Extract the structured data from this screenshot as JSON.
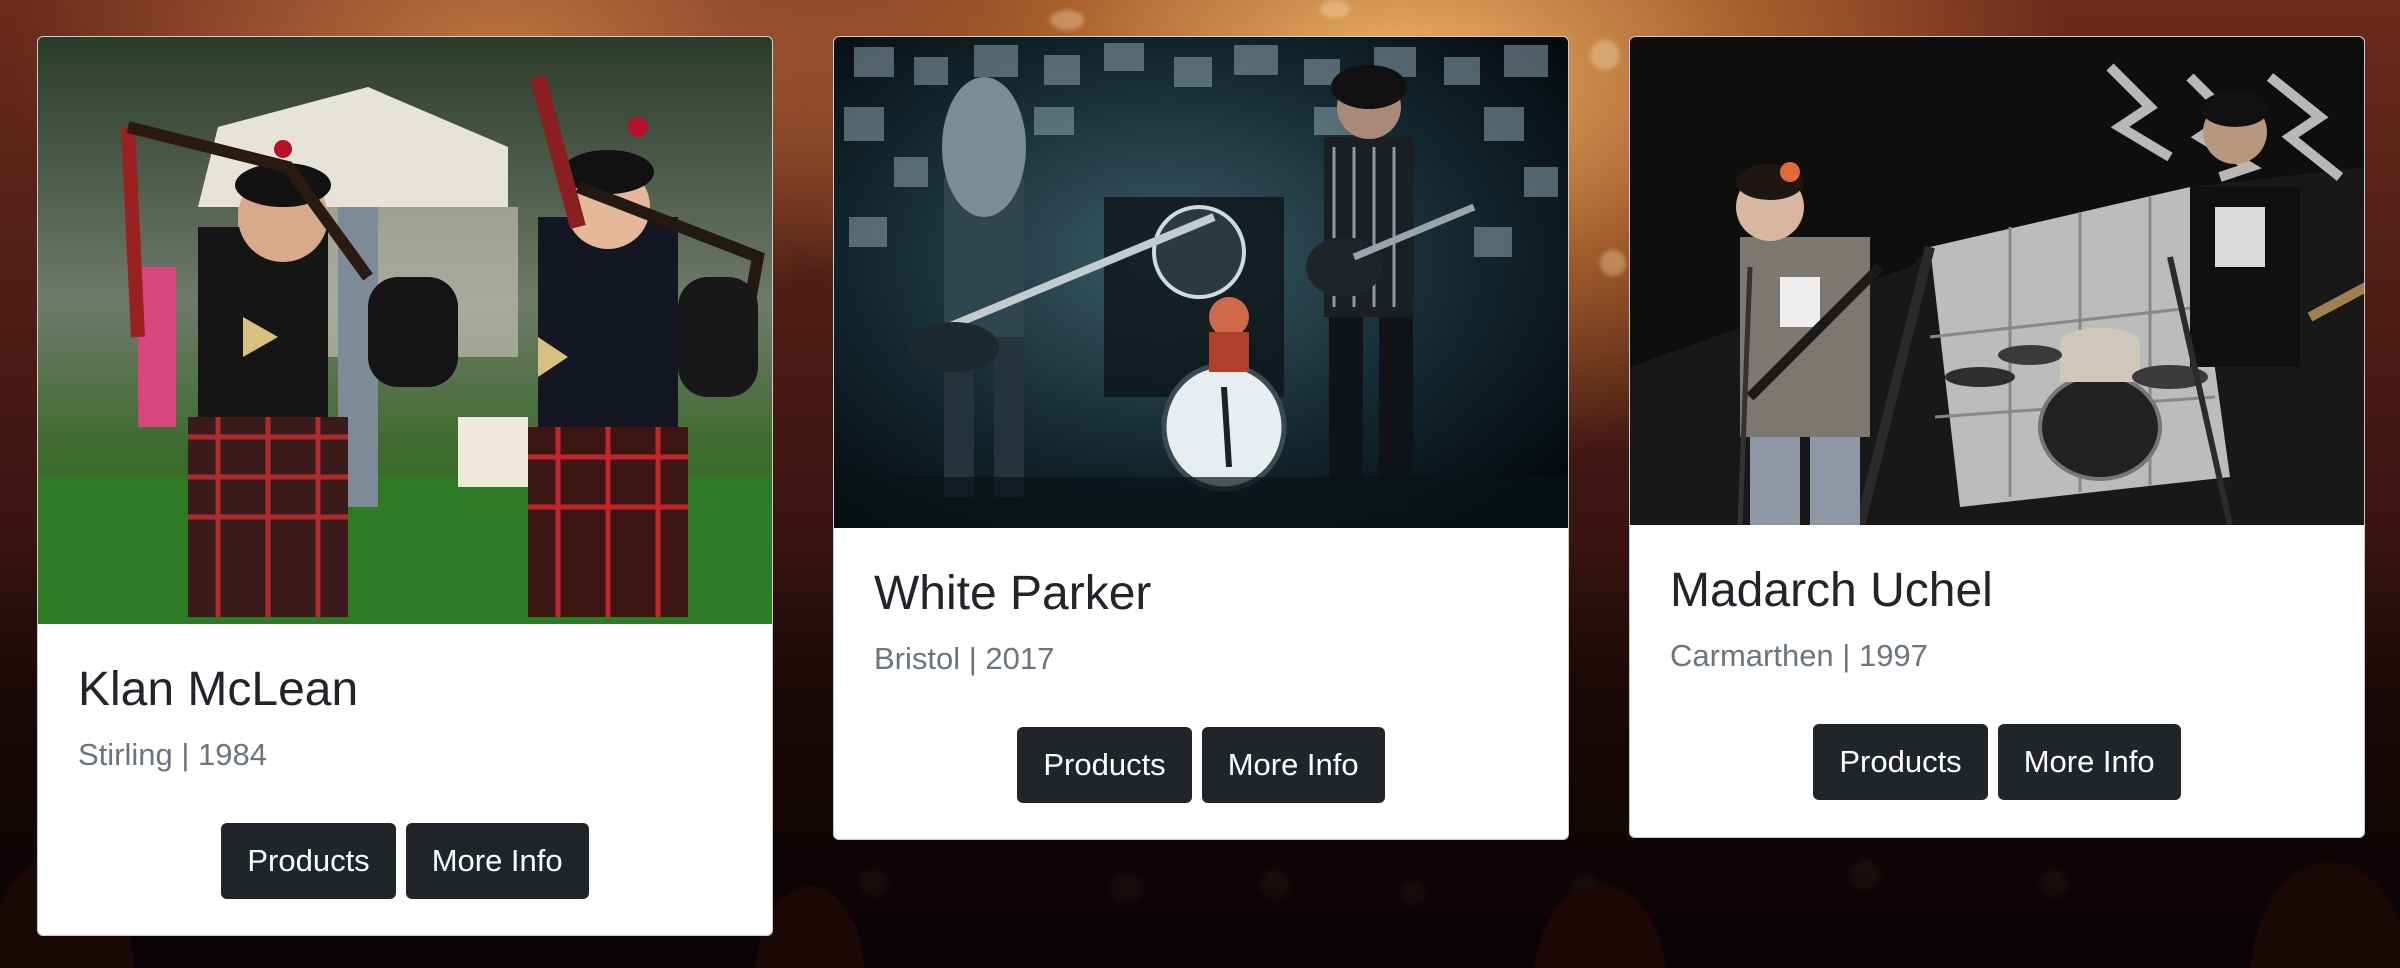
{
  "cards": [
    {
      "title": "Klan McLean",
      "subtitle": "Stirling | 1984",
      "products_label": "Products",
      "info_label": "More Info"
    },
    {
      "title": "White Parker",
      "subtitle": "Bristol | 2017",
      "products_label": "Products",
      "info_label": "More Info"
    },
    {
      "title": "Madarch Uchel",
      "subtitle": "Carmarthen | 1997",
      "products_label": "Products",
      "info_label": "More Info"
    }
  ],
  "colors": {
    "button_bg": "#212529",
    "title": "#212529",
    "subtitle": "#6c757d"
  }
}
